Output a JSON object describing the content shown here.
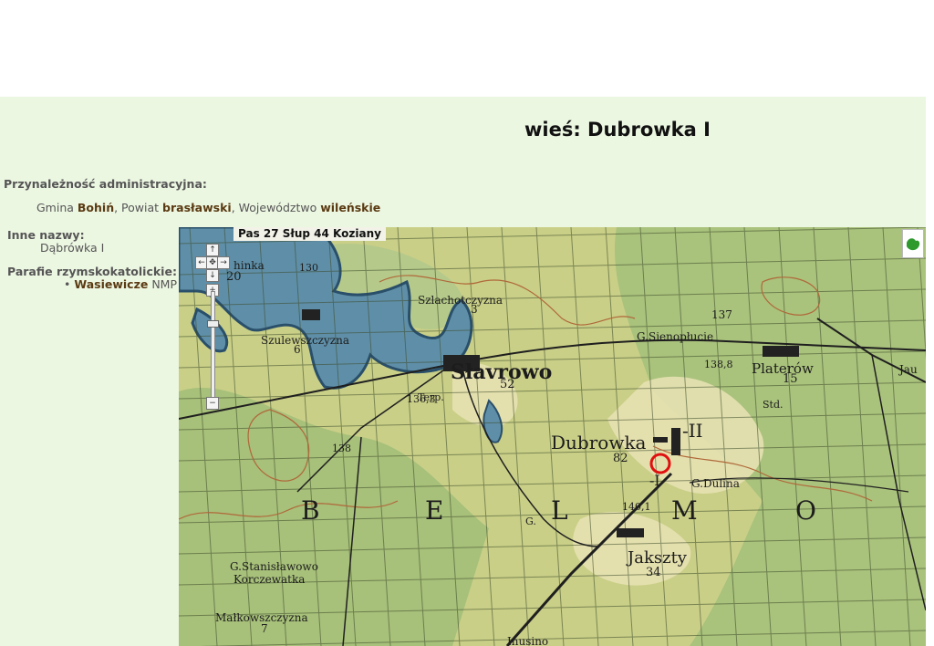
{
  "page": {
    "title": "wieś: Dubrowka I"
  },
  "admin": {
    "heading": "Przynależność administracyjna:",
    "gmina_prefix": "Gmina",
    "gmina": "Bohiń",
    "powiat_prefix": ", Powiat",
    "powiat": "brasławski",
    "woj_prefix": ", Województwo",
    "wojewodztwo": "wileńskie"
  },
  "other_names": {
    "heading": "Inne nazwy:",
    "value": "Dąbrówka I"
  },
  "parishes": {
    "heading": "Parafie rzymskokatolickie:",
    "bullet": "•",
    "name": "Wasiewicze",
    "suffix": "NMP"
  },
  "map": {
    "sheet_label": "Pas 27 Słup 44 Koziany",
    "zoom_up": "↑",
    "zoom_left": "←",
    "zoom_center": "✥",
    "zoom_right": "→",
    "zoom_down": "↓",
    "zoom_plus": "+",
    "zoom_minus": "−",
    "places": [
      "Słavrowo",
      "52",
      "Dubrowka",
      "82",
      "-II",
      "-I",
      "Platerów",
      "15",
      "Jakszty",
      "34",
      "Szulewszczyzna",
      "6",
      "Szlachotczyzna",
      "3",
      "G.Sienopłucie",
      "G.Dulina",
      "G.Stanisławowo",
      "Korczewatka",
      "Małkowszczyzna",
      "7",
      "Inusino",
      "Terp.",
      "Std.",
      "B",
      "E",
      "L",
      "M",
      "O",
      "138,8",
      "140,1",
      "130",
      "138",
      "136,3",
      "137",
      "Jau",
      "20",
      "hinka",
      "G."
    ],
    "colors": {
      "land": "#c9cf87",
      "forest": "#a7c07a",
      "water": "#5f8fa8",
      "water_edge": "#2a4f6a",
      "grid": "#3c4a2a",
      "road": "#1f1f1f",
      "contour": "#b0683a",
      "marker": "#e01010"
    }
  }
}
